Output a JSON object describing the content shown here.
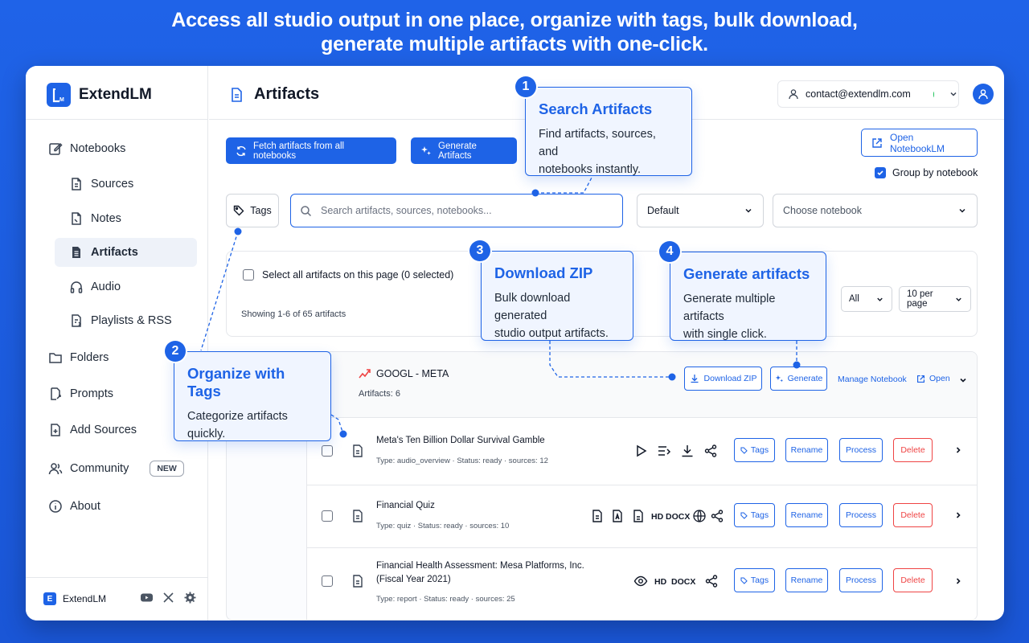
{
  "hero": {
    "line1": "Access all studio output in one place, organize with tags, bulk download,",
    "line2": "generate multiple artifacts with one-click."
  },
  "brand": {
    "logo_text": "LM",
    "name": "ExtendLM"
  },
  "sidebar": {
    "items": [
      {
        "label": "Notebooks",
        "icon": "notebook-edit-icon"
      },
      {
        "label": "Sources",
        "icon": "file-icon"
      },
      {
        "label": "Notes",
        "icon": "note-icon"
      },
      {
        "label": "Artifacts",
        "icon": "document-icon",
        "active": true
      },
      {
        "label": "Audio",
        "icon": "headphones-icon"
      },
      {
        "label": "Playlists & RSS",
        "icon": "playlist-icon"
      },
      {
        "label": "Folders",
        "icon": "folder-icon"
      },
      {
        "label": "Prompts",
        "icon": "prompt-icon"
      },
      {
        "label": "Add Sources",
        "icon": "add-file-icon"
      },
      {
        "label": "Community",
        "icon": "users-icon",
        "badge": "NEW"
      },
      {
        "label": "About",
        "icon": "info-icon"
      }
    ],
    "footer": {
      "logo_text": "E",
      "name": "ExtendLM"
    }
  },
  "header": {
    "title": "Artifacts",
    "account_email": "contact@extendlm.com",
    "status_color": "#22c55e"
  },
  "actions": {
    "fetch_label": "Fetch artifacts from all notebooks",
    "generate_label": "Generate Artifacts",
    "open_notebooklm_label": "Open NotebookLM",
    "group_by_label": "Group by notebook",
    "group_by_checked": true
  },
  "filters": {
    "tags_label": "Tags",
    "search_placeholder": "Search artifacts, sources, notebooks...",
    "sort_value": "Default",
    "notebook_placeholder": "Choose notebook"
  },
  "toolbar": {
    "select_all_label": "Select all artifacts on this page (0 selected)",
    "showing_label": "Showing 1-6 of 65 artifacts",
    "type_filter_value": "All",
    "per_page_value": "10 per page"
  },
  "group": {
    "name": "GOOGL - META",
    "count_label": "Artifacts: 6",
    "download_zip_label": "Download ZIP",
    "generate_label": "Generate",
    "manage_label": "Manage Notebook",
    "open_label": "Open"
  },
  "rows": [
    {
      "title": "Meta's Ten Billion Dollar Survival Gamble",
      "type": "Type: audio_overview",
      "status": "Status: ready",
      "sources": "sources: 12"
    },
    {
      "title": "Financial Quiz",
      "type": "Type: quiz",
      "status": "Status: ready",
      "sources": "sources: 10",
      "hd": "HD",
      "docx": "DOCX"
    },
    {
      "title_line1": "Financial Health Assessment: Mesa Platforms, Inc.",
      "title_line2": "(Fiscal Year 2021)",
      "type": "Type: report",
      "status": "Status: ready",
      "sources": "sources: 25",
      "hd": "HD",
      "docx": "DOCX"
    }
  ],
  "row_actions": {
    "tags": "Tags",
    "rename": "Rename",
    "process": "Process",
    "delete": "Delete"
  },
  "callouts": [
    {
      "num": "1",
      "title": "Search Artifacts",
      "body_line1": "Find artifacts, sources, and",
      "body_line2": "notebooks instantly."
    },
    {
      "num": "2",
      "title": "Organize with Tags",
      "body_line1": "Categorize artifacts",
      "body_line2": "quickly."
    },
    {
      "num": "3",
      "title": "Download ZIP",
      "body_line1": "Bulk download generated",
      "body_line2": "studio output artifacts."
    },
    {
      "num": "4",
      "title": "Generate artifacts",
      "body_line1": "Generate multiple artifacts",
      "body_line2": "with single click."
    }
  ],
  "colors": {
    "accent": "#1e63e6",
    "danger": "#ef4444",
    "background": "#1f63e8"
  }
}
